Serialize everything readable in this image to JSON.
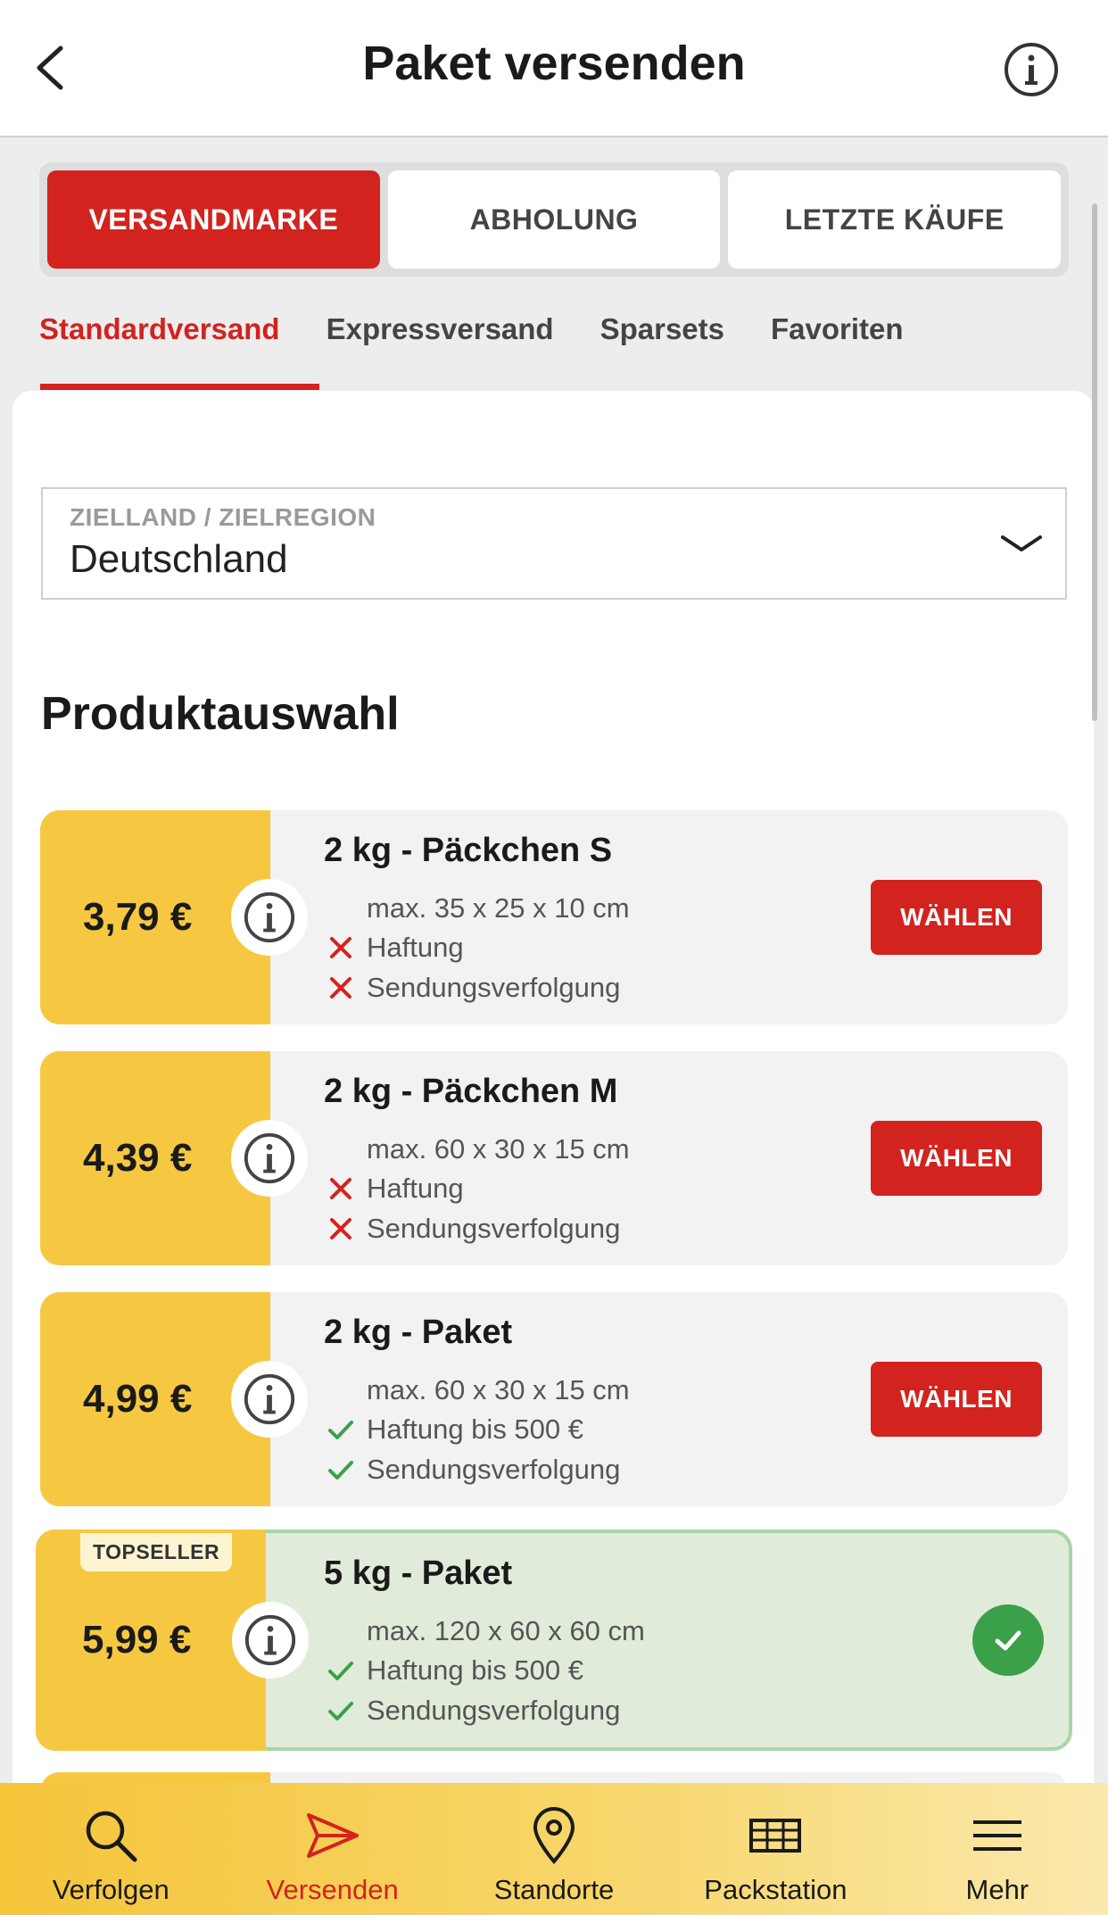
{
  "header": {
    "title": "Paket versenden"
  },
  "segments": [
    {
      "label": "VERSANDMARKE",
      "active": true
    },
    {
      "label": "ABHOLUNG",
      "active": false
    },
    {
      "label": "LETZTE KÄUFE",
      "active": false
    }
  ],
  "subtabs": [
    {
      "label": "Standardversand",
      "active": true
    },
    {
      "label": "Expressversand",
      "active": false
    },
    {
      "label": "Sparsets",
      "active": false
    },
    {
      "label": "Favoriten",
      "active": false
    }
  ],
  "destination": {
    "label": "ZIELLAND / ZIELREGION",
    "value": "Deutschland"
  },
  "section_title": "Produktauswahl",
  "products": [
    {
      "price": "3,79 €",
      "name": "2 kg - Päckchen S",
      "dims": "max. 35 x 25 x 10 cm",
      "features": [
        {
          "label": "Haftung",
          "included": false
        },
        {
          "label": "Sendungsverfolgung",
          "included": false
        }
      ],
      "action": "WÄHLEN",
      "selected": false
    },
    {
      "price": "4,39 €",
      "name": "2 kg - Päckchen M",
      "dims": "max. 60 x 30 x 15 cm",
      "features": [
        {
          "label": "Haftung",
          "included": false
        },
        {
          "label": "Sendungsverfolgung",
          "included": false
        }
      ],
      "action": "WÄHLEN",
      "selected": false
    },
    {
      "price": "4,99 €",
      "name": "2 kg - Paket",
      "dims": "max. 60 x 30 x 15 cm",
      "features": [
        {
          "label": "Haftung bis 500 €",
          "included": true
        },
        {
          "label": "Sendungsverfolgung",
          "included": true
        }
      ],
      "action": "WÄHLEN",
      "selected": false
    },
    {
      "price": "5,99 €",
      "name": "5 kg - Paket",
      "dims": "max. 120 x 60 x 60 cm",
      "badge": "TOPSELLER",
      "features": [
        {
          "label": "Haftung bis 500 €",
          "included": true
        },
        {
          "label": "Sendungsverfolgung",
          "included": true
        }
      ],
      "selected": true
    }
  ],
  "bottom_nav": [
    {
      "label": "Verfolgen",
      "icon": "search-icon",
      "active": false
    },
    {
      "label": "Versenden",
      "icon": "send-icon",
      "active": true
    },
    {
      "label": "Standorte",
      "icon": "location-pin-icon",
      "active": false
    },
    {
      "label": "Packstation",
      "icon": "packstation-icon",
      "active": false
    },
    {
      "label": "Mehr",
      "icon": "menu-icon",
      "active": false
    }
  ],
  "colors": {
    "brand_red": "#d2231f",
    "brand_yellow": "#f6c842",
    "success_green": "#3aa14a",
    "cross_red": "#d2231f"
  }
}
